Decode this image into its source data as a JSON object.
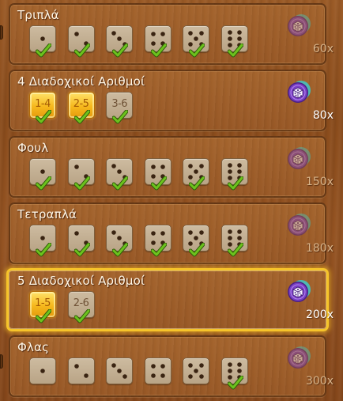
{
  "rows": [
    {
      "title": "Τριπλά",
      "highlighted": false,
      "dice": [
        {
          "kind": "face",
          "value": 1,
          "gold": false,
          "checked": true
        },
        {
          "kind": "face",
          "value": 2,
          "gold": false,
          "checked": true
        },
        {
          "kind": "face",
          "value": 3,
          "gold": false,
          "checked": true
        },
        {
          "kind": "face",
          "value": 4,
          "gold": false,
          "checked": true
        },
        {
          "kind": "face",
          "value": 5,
          "gold": false,
          "checked": true
        },
        {
          "kind": "face",
          "value": 6,
          "gold": false,
          "checked": true
        }
      ],
      "reward": {
        "icon": "purple-dice-token-icon",
        "active": false,
        "multiplier": "60x"
      }
    },
    {
      "title": "4 Διαδοχικοί Αριθμοί",
      "highlighted": false,
      "dice": [
        {
          "kind": "seq",
          "label": "1-4",
          "gold": true,
          "checked": true
        },
        {
          "kind": "seq",
          "label": "2-5",
          "gold": true,
          "checked": true
        },
        {
          "kind": "seq",
          "label": "3-6",
          "gold": false,
          "checked": true
        }
      ],
      "reward": {
        "icon": "purple-dice-token-icon",
        "active": true,
        "multiplier": "80x"
      }
    },
    {
      "title": "Φουλ",
      "highlighted": false,
      "dice": [
        {
          "kind": "face",
          "value": 1,
          "gold": false,
          "checked": true
        },
        {
          "kind": "face",
          "value": 2,
          "gold": false,
          "checked": true
        },
        {
          "kind": "face",
          "value": 3,
          "gold": false,
          "checked": true
        },
        {
          "kind": "face",
          "value": 4,
          "gold": false,
          "checked": true
        },
        {
          "kind": "face",
          "value": 5,
          "gold": false,
          "checked": true
        },
        {
          "kind": "face",
          "value": 6,
          "gold": false,
          "checked": true
        }
      ],
      "reward": {
        "icon": "purple-dice-token-icon",
        "active": false,
        "multiplier": "150x"
      }
    },
    {
      "title": "Τετραπλά",
      "highlighted": false,
      "dice": [
        {
          "kind": "face",
          "value": 1,
          "gold": false,
          "checked": true
        },
        {
          "kind": "face",
          "value": 2,
          "gold": false,
          "checked": true
        },
        {
          "kind": "face",
          "value": 3,
          "gold": false,
          "checked": true
        },
        {
          "kind": "face",
          "value": 4,
          "gold": false,
          "checked": true
        },
        {
          "kind": "face",
          "value": 5,
          "gold": false,
          "checked": true
        },
        {
          "kind": "face",
          "value": 6,
          "gold": false,
          "checked": true
        }
      ],
      "reward": {
        "icon": "purple-dice-token-icon",
        "active": false,
        "multiplier": "180x"
      }
    },
    {
      "title": "5 Διαδοχικοί Αριθμοί",
      "highlighted": true,
      "dice": [
        {
          "kind": "seq",
          "label": "1-5",
          "gold": true,
          "checked": true
        },
        {
          "kind": "seq",
          "label": "2-6",
          "gold": false,
          "checked": true
        }
      ],
      "reward": {
        "icon": "purple-dice-token-icon",
        "active": true,
        "multiplier": "200x"
      }
    },
    {
      "title": "Φλας",
      "highlighted": false,
      "dice": [
        {
          "kind": "face",
          "value": 1,
          "gold": false,
          "checked": false
        },
        {
          "kind": "face",
          "value": 2,
          "gold": false,
          "checked": false
        },
        {
          "kind": "face",
          "value": 3,
          "gold": false,
          "checked": false
        },
        {
          "kind": "face",
          "value": 4,
          "gold": false,
          "checked": false
        },
        {
          "kind": "face",
          "value": 5,
          "gold": false,
          "checked": false
        },
        {
          "kind": "face",
          "value": 6,
          "gold": false,
          "checked": true
        }
      ],
      "reward": {
        "icon": "purple-dice-token-icon",
        "active": false,
        "multiplier": "300x"
      }
    }
  ],
  "colors": {
    "wood": "#9a5a26",
    "panel_border": "#3c1e08",
    "highlight_border": "#f6c42a",
    "check_green": "#6cc21e",
    "token_purple": "#7a3fc4",
    "token_teal": "#3fc8c8"
  }
}
